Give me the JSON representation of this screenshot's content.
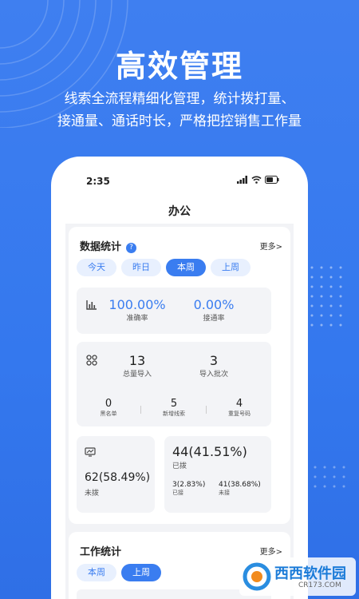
{
  "promo": {
    "headline": "高效管理",
    "sub1": "线索全流程精细化管理，统计拨打量、",
    "sub2": "接通量、通话时长，严格把控销售工作量"
  },
  "status_bar": {
    "time": "2:35"
  },
  "nav": {
    "title": "办公"
  },
  "data_stats": {
    "title": "数据统计",
    "help": "?",
    "more": "更多>",
    "tabs": [
      "今天",
      "昨日",
      "本周",
      "上周"
    ],
    "active_tab": "本周",
    "accuracy_value": "100.00%",
    "accuracy_label": "准确率",
    "connect_value": "0.00%",
    "connect_label": "接通率",
    "total_import_value": "13",
    "total_import_label": "总量导入",
    "import_batch_value": "3",
    "import_batch_label": "导入批次",
    "blacklist_value": "0",
    "blacklist_label": "黑名单",
    "new_leads_value": "5",
    "new_leads_label": "新增线索",
    "dup_value": "4",
    "dup_label": "重复号码",
    "undialed_value": "62(58.49%)",
    "undialed_label": "未拨",
    "dialed_value": "44(41.51%)",
    "dialed_label": "已拨",
    "connected_value": "3(2.83%)",
    "connected_label": "已接",
    "not_connected_value": "41(38.68%)",
    "not_connected_label": "未接"
  },
  "work_stats": {
    "title": "工作统计",
    "more": "更多>",
    "tabs": [
      "本周",
      "上周"
    ],
    "active_tab": "上周"
  },
  "colors": {
    "accent": "#3a7df0",
    "background": "#3478ee"
  },
  "watermark": {
    "text": "西西软件园",
    "sub": "CR173.COM"
  }
}
